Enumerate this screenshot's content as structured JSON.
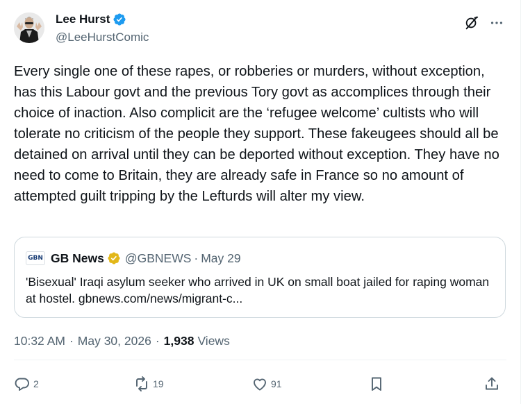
{
  "author": {
    "display_name": "Lee Hurst",
    "handle": "@LeeHurstComic"
  },
  "post": {
    "text": "Every single one of these rapes, or robberies or murders, without exception, has this Labour govt and the previous Tory govt as accomplices through their choice of inaction. Also complicit are the ‘refugee welcome’ cultists who will tolerate no criticism of the people they support. These fakeugees should all be detained on arrival until they can be deported without exception. They have no need to come to Britain, they are already safe in France so no amount of attempted guilt tripping by the Lefturds will alter my view."
  },
  "quote": {
    "logo_text": "GBN",
    "name": "GB News",
    "handle": "@GBNEWS",
    "separator": "·",
    "date": "May 29",
    "text": "'Bisexual' Iraqi asylum seeker who arrived in UK on small boat jailed for raping woman at hostel. gbnews.com/news/migrant-c..."
  },
  "meta": {
    "time": "10:32 AM",
    "separator": "·",
    "date": "May 30, 2026",
    "separator2": "·",
    "views_count": "1,938",
    "views_label": "Views"
  },
  "actions": {
    "replies": "2",
    "reposts": "19",
    "likes": "91"
  },
  "colors": {
    "verified_blue": "#1d9bf0",
    "verified_gold": "#e2b719",
    "secondary_text": "#536471",
    "primary_text": "#0f1419",
    "border": "#cfd9de"
  },
  "icons": [
    "avatar",
    "verified-badge-icon",
    "grok-icon",
    "more-icon",
    "gold-verified-badge-icon",
    "reply-icon",
    "repost-icon",
    "like-icon",
    "bookmark-icon",
    "share-icon"
  ]
}
